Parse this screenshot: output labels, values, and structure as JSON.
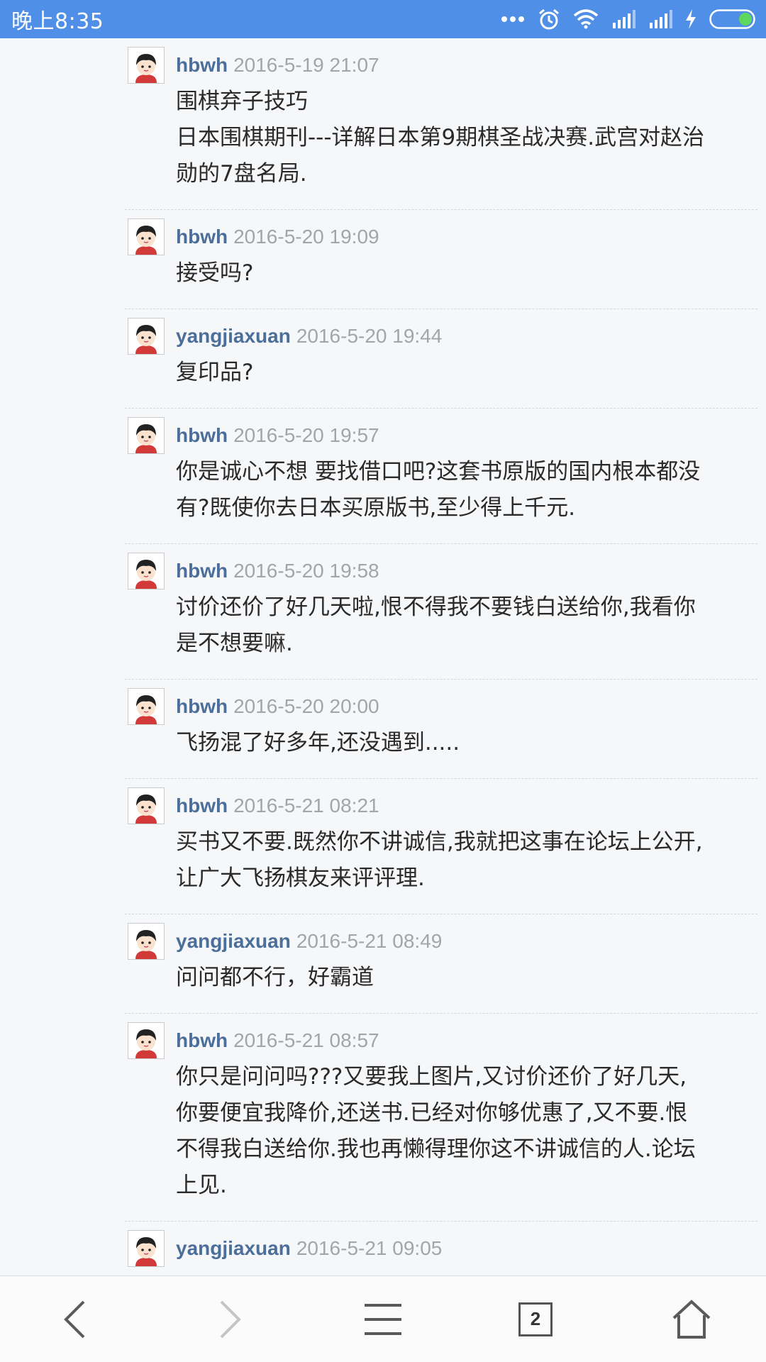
{
  "status_bar": {
    "time": "晚上8:35",
    "background": "#4f8fe7",
    "icons": [
      "more-dots-icon",
      "alarm-icon",
      "wifi-icon",
      "signal-icon",
      "signal-icon",
      "charging-icon",
      "battery-icon"
    ]
  },
  "posts": [
    {
      "user": "hbwh",
      "time": "2016-5-19 21:07",
      "lines": [
        "围棋弃子技巧",
        "日本围棋期刊---详解日本第9期棋圣战决赛.武宫对赵治",
        "勋的7盘名局."
      ]
    },
    {
      "user": "hbwh",
      "time": "2016-5-20 19:09",
      "lines": [
        "接受吗?"
      ]
    },
    {
      "user": "yangjiaxuan",
      "time": "2016-5-20 19:44",
      "lines": [
        "复印品?"
      ]
    },
    {
      "user": "hbwh",
      "time": "2016-5-20 19:57",
      "lines": [
        "你是诚心不想 要找借口吧?这套书原版的国内根本都没",
        "有?既使你去日本买原版书,至少得上千元."
      ]
    },
    {
      "user": "hbwh",
      "time": "2016-5-20 19:58",
      "lines": [
        "讨价还价了好几天啦,恨不得我不要钱白送给你,我看你",
        "是不想要嘛."
      ]
    },
    {
      "user": "hbwh",
      "time": "2016-5-20 20:00",
      "lines": [
        "飞扬混了好多年,还没遇到....."
      ]
    },
    {
      "user": "hbwh",
      "time": "2016-5-21 08:21",
      "lines": [
        "买书又不要.既然你不讲诚信,我就把这事在论坛上公开,",
        "让广大飞扬棋友来评评理."
      ]
    },
    {
      "user": "yangjiaxuan",
      "time": "2016-5-21 08:49",
      "lines": [
        "问问都不行，好霸道"
      ]
    },
    {
      "user": "hbwh",
      "time": "2016-5-21 08:57",
      "lines": [
        "你只是问问吗???又要我上图片,又讨价还价了好几天,",
        "你要便宜我降价,还送书.已经对你够优惠了,又不要.恨",
        "不得我白送给你.我也再懒得理你这不讲诚信的人.论坛",
        "上见."
      ]
    },
    {
      "user": "yangjiaxuan",
      "time": "2016-5-21 09:05",
      "lines": [
        ""
      ]
    }
  ],
  "nav_bar": {
    "tab_count": "2",
    "icons": [
      "back-arrow-icon",
      "forward-arrow-icon",
      "menu-icon",
      "tabs-icon",
      "home-icon"
    ]
  },
  "colors": {
    "username": "#4b6e9b",
    "timestamp": "#a2a5a9",
    "body_text": "#2a2a2a"
  }
}
